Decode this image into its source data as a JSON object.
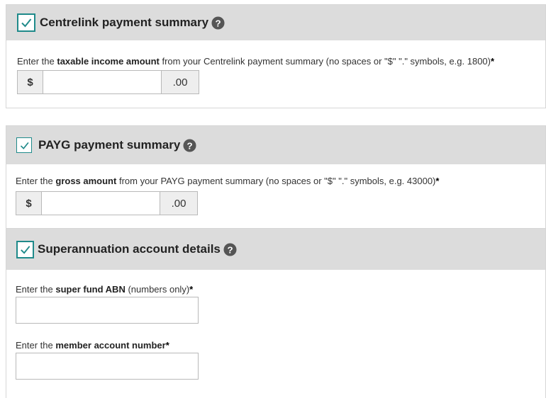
{
  "sections": [
    {
      "title": "Centrelink payment summary",
      "prompt_before": "Enter the ",
      "prompt_bold": "taxable income amount",
      "prompt_after": " from your Centrelink payment summary (no spaces or \"$\" \".\" symbols, e.g. 1800)",
      "required_mark": "*",
      "prefix": "$",
      "suffix": ".00",
      "value": ""
    },
    {
      "title": "PAYG payment summary",
      "prompt_before": "Enter the ",
      "prompt_bold": "gross amount",
      "prompt_after": " from your PAYG payment summary (no spaces or \"$\" \".\" symbols, e.g. 43000)",
      "required_mark": "*",
      "prefix": "$",
      "suffix": ".00",
      "value": ""
    },
    {
      "title": "Superannuation account details",
      "fields": [
        {
          "prompt_before": "Enter the ",
          "prompt_bold": "super fund ABN",
          "prompt_after": " (numbers only)",
          "required_mark": "*",
          "value": ""
        },
        {
          "prompt_before": "Enter the ",
          "prompt_bold": "member account number",
          "prompt_after": "",
          "required_mark": "*",
          "value": ""
        }
      ]
    }
  ],
  "colors": {
    "checkbox_border": "#1f8a8a",
    "checkmark": "#1f8a8a",
    "header_bg": "#dcdcdc",
    "help_icon": "#555555"
  },
  "icons": {
    "checkbox": "checkbox-checked-icon",
    "help": "question-circle-icon"
  }
}
